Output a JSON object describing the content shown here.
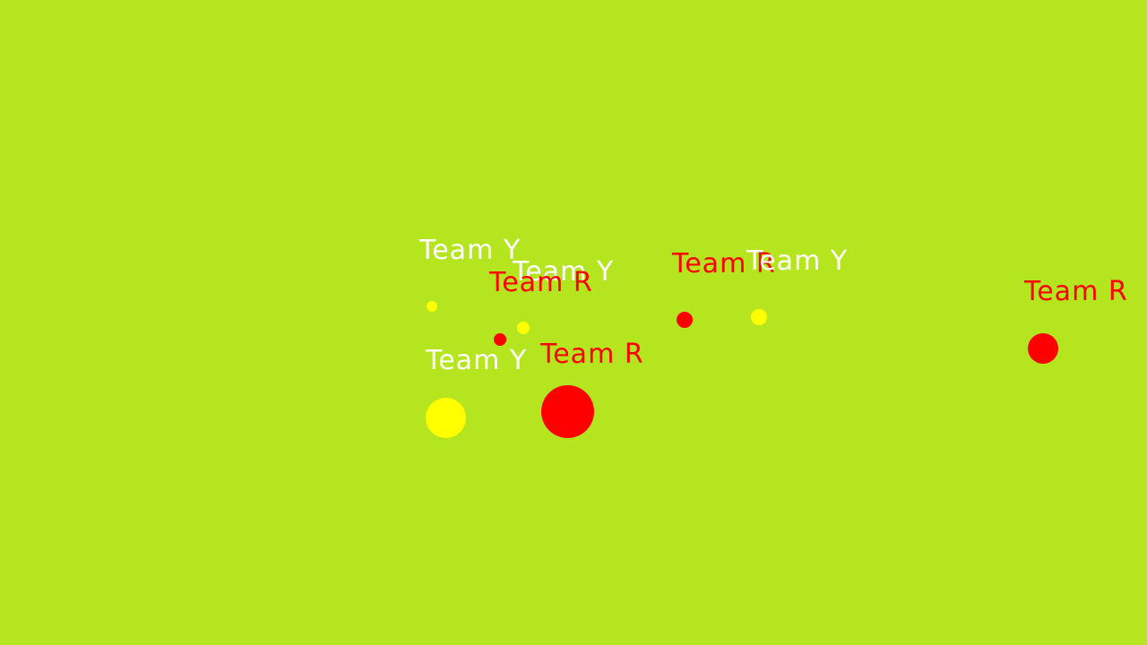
{
  "colors": {
    "field": "#b5e51f",
    "team_y": "#ffff00",
    "team_r": "#ff0000",
    "label_y": "#ffffff",
    "label_r": "#ff0000"
  },
  "players": [
    {
      "team": "Y",
      "label": "Team Y"
    },
    {
      "team": "Y",
      "label": "Team Y"
    },
    {
      "team": "R",
      "label": "Team R"
    },
    {
      "team": "Y",
      "label": "Team Y"
    },
    {
      "team": "R",
      "label": "Team R"
    },
    {
      "team": "R",
      "label": "Team R"
    },
    {
      "team": "Y",
      "label": "Team Y"
    },
    {
      "team": "R",
      "label": "Team R"
    }
  ]
}
